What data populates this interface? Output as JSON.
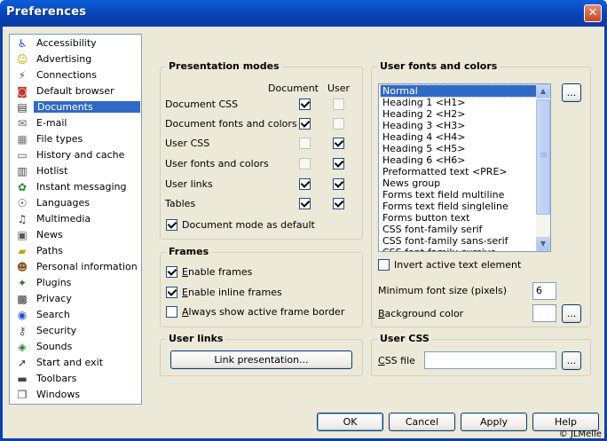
{
  "window": {
    "title": "Preferences",
    "close_label": "✕"
  },
  "sidebar": {
    "items": [
      {
        "label": "Accessibility",
        "icon": "accessibility-icon",
        "glyph": "♿",
        "color": "#1c4fd0"
      },
      {
        "label": "Advertising",
        "icon": "smiley-icon",
        "glyph": "☺",
        "color": "#c8a400"
      },
      {
        "label": "Connections",
        "icon": "plug-icon",
        "glyph": "⚡",
        "color": "#555"
      },
      {
        "label": "Default browser",
        "icon": "default-browser-icon",
        "glyph": "◙",
        "color": "#c0392b"
      },
      {
        "label": "Documents",
        "icon": "document-icon",
        "glyph": "▤",
        "color": "#333"
      },
      {
        "label": "E-mail",
        "icon": "mail-icon",
        "glyph": "✉",
        "color": "#666"
      },
      {
        "label": "File types",
        "icon": "file-types-icon",
        "glyph": "▦",
        "color": "#777"
      },
      {
        "label": "History and cache",
        "icon": "history-icon",
        "glyph": "▭",
        "color": "#555"
      },
      {
        "label": "Hotlist",
        "icon": "hotlist-icon",
        "glyph": "▥",
        "color": "#444"
      },
      {
        "label": "Instant messaging",
        "icon": "messaging-icon",
        "glyph": "✿",
        "color": "#2a8a2a"
      },
      {
        "label": "Languages",
        "icon": "languages-icon",
        "glyph": "☉",
        "color": "#446"
      },
      {
        "label": "Multimedia",
        "icon": "multimedia-icon",
        "glyph": "♫",
        "color": "#333"
      },
      {
        "label": "News",
        "icon": "news-icon",
        "glyph": "▣",
        "color": "#555"
      },
      {
        "label": "Paths",
        "icon": "folder-icon",
        "glyph": "▰",
        "color": "#c8a400"
      },
      {
        "label": "Personal information",
        "icon": "person-icon",
        "glyph": "☻",
        "color": "#8a5a2a"
      },
      {
        "label": "Plugins",
        "icon": "plugins-icon",
        "glyph": "✦",
        "color": "#2a7a2a"
      },
      {
        "label": "Privacy",
        "icon": "privacy-icon",
        "glyph": "▩",
        "color": "#333"
      },
      {
        "label": "Search",
        "icon": "search-icon",
        "glyph": "◉",
        "color": "#1c4fd0"
      },
      {
        "label": "Security",
        "icon": "key-icon",
        "glyph": "⚷",
        "color": "#555"
      },
      {
        "label": "Sounds",
        "icon": "sound-icon",
        "glyph": "◈",
        "color": "#2a7a2a"
      },
      {
        "label": "Start and exit",
        "icon": "start-exit-icon",
        "glyph": "➚",
        "color": "#333"
      },
      {
        "label": "Toolbars",
        "icon": "toolbar-icon",
        "glyph": "▬",
        "color": "#444"
      },
      {
        "label": "Windows",
        "icon": "windows-icon",
        "glyph": "❐",
        "color": "#444"
      }
    ],
    "selected_index": 4
  },
  "presentation": {
    "title": "Presentation modes",
    "col_document": "Document",
    "col_user": "User",
    "rows": [
      {
        "label": "Document CSS",
        "document": true,
        "user": false
      },
      {
        "label": "Document fonts and colors",
        "document": true,
        "user": false
      },
      {
        "label": "User CSS",
        "document": false,
        "user": true
      },
      {
        "label": "User fonts and colors",
        "document": false,
        "user": true
      },
      {
        "label": "User links",
        "document": true,
        "user": true
      },
      {
        "label": "Tables",
        "document": true,
        "user": true
      }
    ],
    "default_label": "Document mode as default",
    "default_checked": true
  },
  "frames": {
    "title": "Frames",
    "enable_frames": "Enable frames",
    "enable_inline": "Enable inline frames",
    "show_border": "Always show active frame border",
    "enable_frames_checked": true,
    "enable_inline_checked": true,
    "show_border_checked": false
  },
  "userlinks": {
    "title": "User links",
    "button": "Link presentation..."
  },
  "fonts": {
    "title": "User fonts and colors",
    "list": [
      "Normal",
      "Heading 1 <H1>",
      "Heading 2 <H2>",
      "Heading 3 <H3>",
      "Heading 4 <H4>",
      "Heading 5 <H5>",
      "Heading 6 <H6>",
      "Preformatted text <PRE>",
      "News group",
      "Forms text field multiline",
      "Forms text field singleline",
      "Forms button text",
      "CSS font-family serif",
      "CSS font-family sans-serif",
      "CSS font-family cursive"
    ],
    "selected_index": 0,
    "more_button": "...",
    "invert_label": "Invert active text element",
    "invert_checked": false,
    "min_size_label": "Minimum font size (pixels)",
    "min_size_value": "6",
    "bg_label": "Background color"
  },
  "usercss": {
    "title": "User CSS",
    "file_label": "CSS file",
    "file_value": "",
    "browse": "..."
  },
  "footer": {
    "ok": "OK",
    "cancel": "Cancel",
    "apply": "Apply",
    "help": "Help"
  },
  "credit": "© JLMelle"
}
